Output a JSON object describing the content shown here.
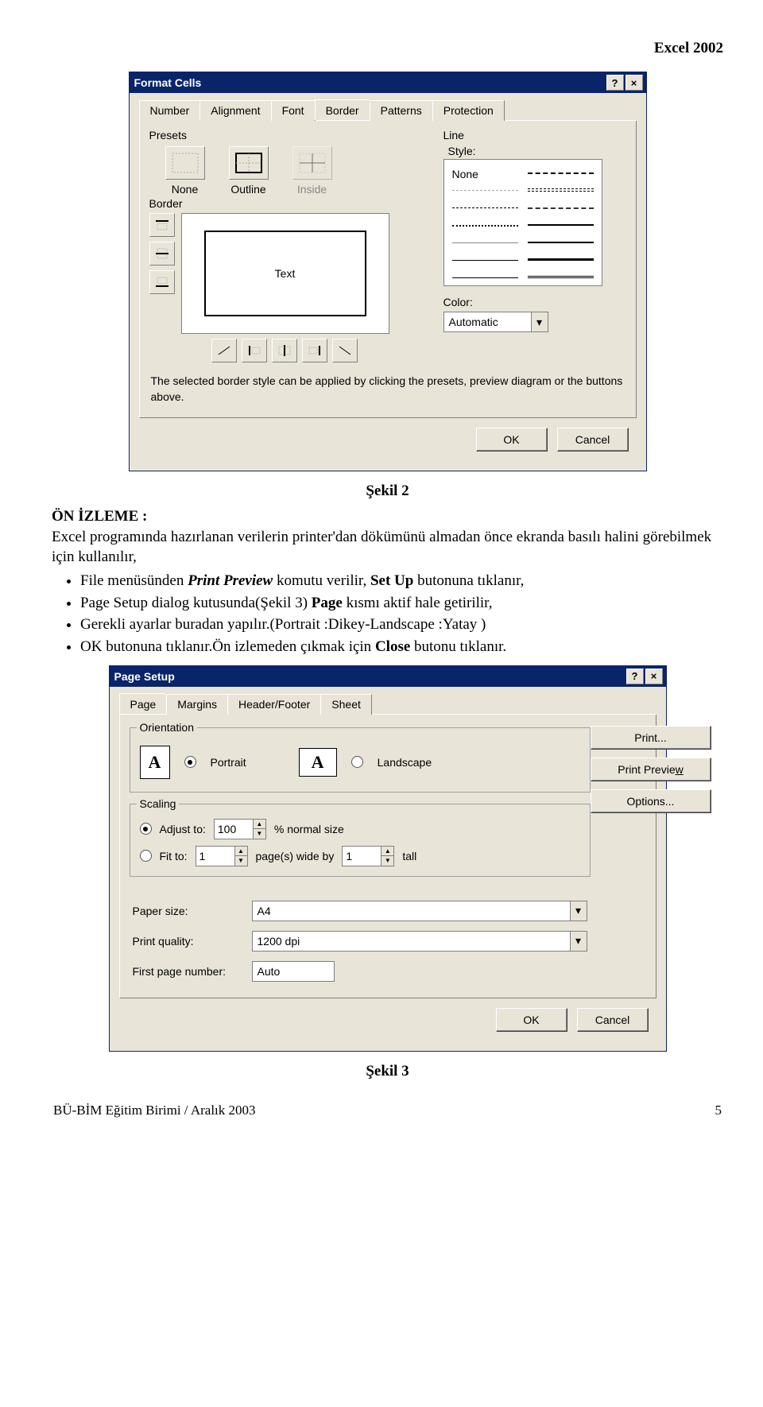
{
  "header": {
    "product": "Excel 2002"
  },
  "format_cells": {
    "title": "Format Cells",
    "tabs": [
      "Number",
      "Alignment",
      "Font",
      "Border",
      "Patterns",
      "Protection"
    ],
    "active_tab": "Border",
    "presets_label": "Presets",
    "presets": {
      "none": "None",
      "outline": "Outline",
      "inside": "Inside"
    },
    "border_label": "Border",
    "preview_text": "Text",
    "line_label": "Line",
    "style_label": "Style:",
    "style_none": "None",
    "color_label": "Color:",
    "color_value": "Automatic",
    "hint": "The selected border style can be applied by clicking the presets, preview diagram or the buttons above.",
    "ok": "OK",
    "cancel": "Cancel"
  },
  "caption1": "Şekil 2",
  "section_title": "ÖN İZLEME :",
  "intro": "Excel programında hazırlanan verilerin printer'dan dökümünü almadan önce ekranda basılı halini görebilmek için kullanılır,",
  "bullets": {
    "b1a": "File menüsünden ",
    "b1b": "Print Preview",
    "b1c": " komutu verilir, ",
    "b1d": "Set Up",
    "b1e": " butonuna tıklanır,",
    "b2a": "Page Setup dialog kutusunda(Şekil 3) ",
    "b2b": "Page",
    "b2c": " kısmı aktif hale getirilir,",
    "b3": "Gerekli ayarlar buradan yapılır.(Portrait :Dikey-Landscape :Yatay )",
    "b4a": "OK butonuna tıklanır.Ön izlemeden çıkmak için ",
    "b4b": "Close",
    "b4c": " butonu tıklanır."
  },
  "page_setup": {
    "title": "Page Setup",
    "tabs": [
      "Page",
      "Margins",
      "Header/Footer",
      "Sheet"
    ],
    "active_tab": "Page",
    "orientation_label": "Orientation",
    "portrait": "Portrait",
    "landscape": "Landscape",
    "scaling_label": "Scaling",
    "adjust_to": "Adjust to:",
    "adjust_value": "100",
    "adjust_suffix": "% normal size",
    "fit_to": "Fit to:",
    "fit_w": "1",
    "fit_mid": "page(s) wide by",
    "fit_h": "1",
    "fit_suffix": "tall",
    "paper_size_label": "Paper size:",
    "paper_size_value": "A4",
    "print_quality_label": "Print quality:",
    "print_quality_value": "1200 dpi",
    "first_page_label": "First page number:",
    "first_page_value": "Auto",
    "btn_print": "Print...",
    "btn_preview": "Print Preview",
    "btn_options": "Options...",
    "ok": "OK",
    "cancel": "Cancel",
    "underline_w": "w",
    "underline_r": "r"
  },
  "caption2": "Şekil 3",
  "footer": {
    "left": "BÜ-BİM Eğitim Birimi / Aralık 2003",
    "right": "5"
  }
}
